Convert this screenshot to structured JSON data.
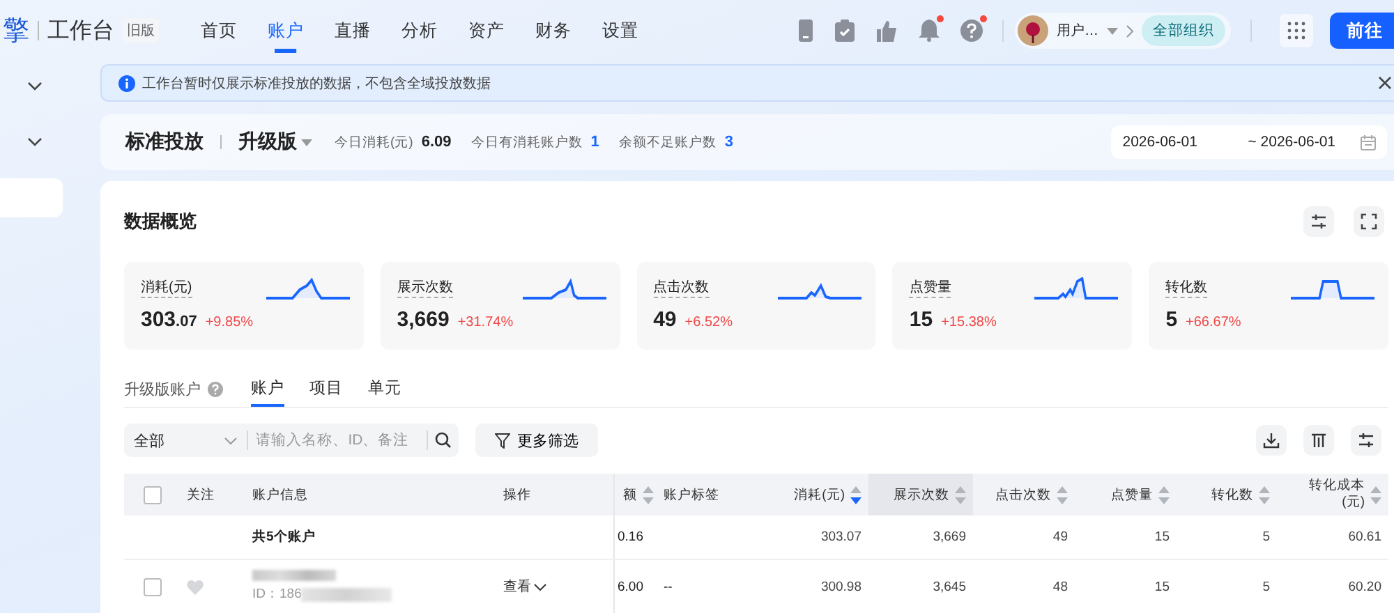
{
  "top_nav": {
    "logo": "擎",
    "title": "工作台",
    "badge": "旧版",
    "menu": [
      {
        "label": "首页",
        "selected": false
      },
      {
        "label": "账户",
        "selected": true
      },
      {
        "label": "直播",
        "selected": false
      },
      {
        "label": "分析",
        "selected": false
      },
      {
        "label": "资产",
        "selected": false
      },
      {
        "label": "财务",
        "selected": false
      },
      {
        "label": "设置",
        "selected": false
      }
    ],
    "tools": [
      {
        "kind": "phone",
        "dot": false
      },
      {
        "kind": "clipboard",
        "dot": false
      },
      {
        "kind": "thumb",
        "dot": false
      },
      {
        "kind": "bell",
        "dot": true
      },
      {
        "kind": "help",
        "dot": true
      }
    ],
    "user": "用户…",
    "org": "全部组织",
    "cta": "前往"
  },
  "notice": {
    "text": "工作台暂时仅展示标准投放的数据，不包含全域投放数据"
  },
  "header": {
    "title": "标准投放",
    "version": "升级版",
    "stats": [
      {
        "label": "今日消耗(元)",
        "value": "6.09",
        "highlight": false
      },
      {
        "label": "今日有消耗账户数",
        "value": "1",
        "highlight": true
      },
      {
        "label": "余额不足账户数",
        "value": "3",
        "highlight": true
      }
    ],
    "date_start": "2026-06-01",
    "date_end": "~ 2026-06-01"
  },
  "overview": {
    "title": "数据概览",
    "metrics": [
      {
        "label": "消耗(元)",
        "value": "303",
        "fraction": ".07",
        "change": "+9.85%"
      },
      {
        "label": "展示次数",
        "value": "3,669",
        "change": "+31.74%"
      },
      {
        "label": "点击次数",
        "value": "49",
        "change": "+6.52%"
      },
      {
        "label": "点赞量",
        "value": "15",
        "change": "+15.38%"
      },
      {
        "label": "转化数",
        "value": "5",
        "change": "+66.67%"
      }
    ]
  },
  "tabs": {
    "label": "升级版账户",
    "items": [
      {
        "label": "账户",
        "selected": true
      },
      {
        "label": "项目",
        "selected": false
      },
      {
        "label": "单元",
        "selected": false
      }
    ]
  },
  "filter": {
    "scope": "全部",
    "placeholder": "请输入名称、ID、备注",
    "more": "更多筛选"
  },
  "table": {
    "select_all": {
      "checked": false
    },
    "columns": [
      {
        "label": "关注",
        "sortable": false,
        "hovered": false
      },
      {
        "label": "账户信息",
        "sortable": false,
        "hovered": false
      },
      {
        "label": "操作",
        "sortable": false,
        "hovered": false
      },
      {
        "label": "额",
        "sortable": true,
        "sorted_desc": false,
        "hovered": false
      },
      {
        "label": "账户标签",
        "sortable": false,
        "hovered": false
      },
      {
        "label": "消耗(元)",
        "sortable": true,
        "sorted_desc": true,
        "hovered": false
      },
      {
        "label": "展示次数",
        "sortable": true,
        "sorted_desc": false,
        "hovered": true
      },
      {
        "label": "点击次数",
        "sortable": true,
        "sorted_desc": false,
        "hovered": false
      },
      {
        "label": "点赞量",
        "sortable": true,
        "sorted_desc": false,
        "hovered": false
      },
      {
        "label": "转化数",
        "sortable": true,
        "sorted_desc": false,
        "hovered": false
      },
      {
        "label": "转化成本(元)",
        "sortable": true,
        "sorted_desc": false,
        "hovered": false
      }
    ],
    "summary": {
      "cells": [
        "",
        "共5个账户",
        "",
        "0.16",
        "",
        "303.07",
        "3,669",
        "49",
        "15",
        "5",
        "60.61"
      ]
    },
    "rows": [
      {
        "checked": false,
        "followed": false,
        "cells": [
          "",
          "ID：186",
          "查看",
          "6.00",
          "--",
          "300.98",
          "3,645",
          "48",
          "15",
          "5",
          "60.20"
        ]
      }
    ]
  }
}
